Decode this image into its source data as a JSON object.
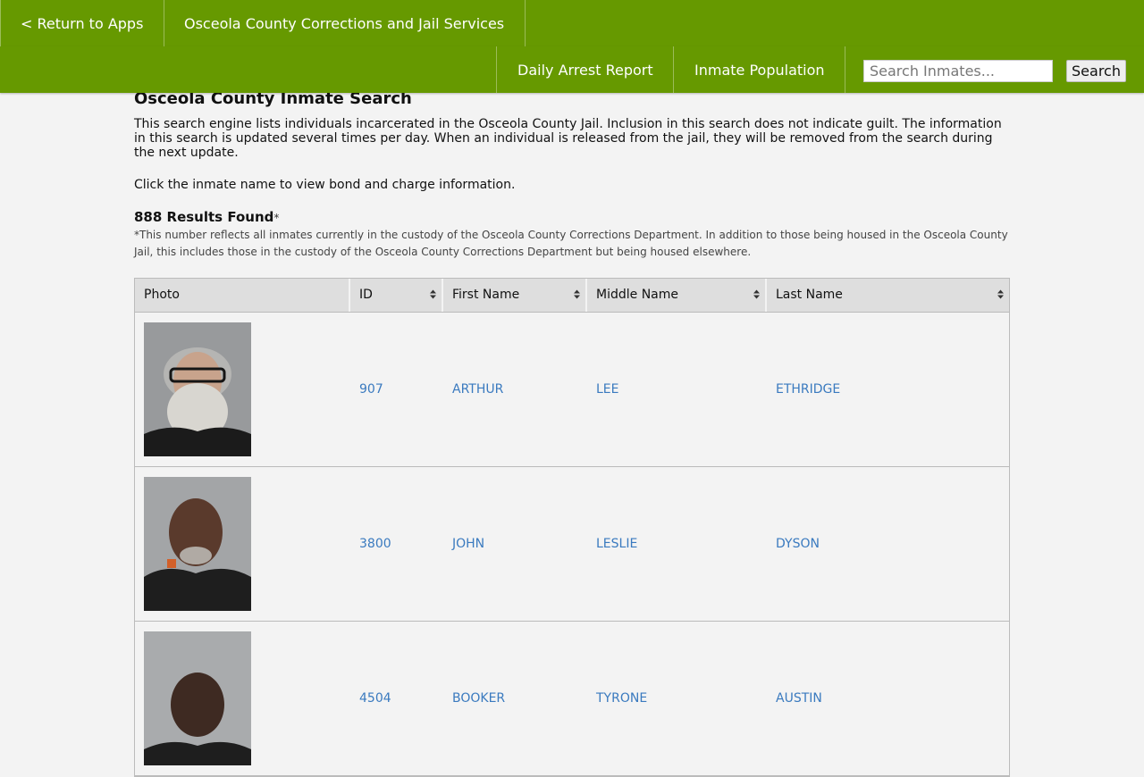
{
  "header": {
    "return_label": "< Return to Apps",
    "site_title": "Osceola County Corrections and Jail Services"
  },
  "subnav": {
    "daily_arrest_label": "Daily Arrest Report",
    "inmate_population_label": "Inmate Population",
    "search_placeholder": "Search Inmates...",
    "search_button_label": "Search"
  },
  "page": {
    "title": "Osceola County Inmate Search",
    "intro": "This search engine lists individuals incarcerated in the Osceola County Jail. Inclusion in this search does not indicate guilt. The information in this search is updated several times per day. When an individual is released from the jail, they will be removed from the search during the next update.",
    "instruction": "Click the inmate name to view bond and charge information.",
    "results_count": "888 Results Found",
    "results_asterisk": "*",
    "footnote": "*This number reflects all inmates currently in the custody of the Osceola County Corrections Department. In addition to those being housed in the Osceola County Jail, this includes those in the custody of the Osceola County Corrections Department but being housed elsewhere."
  },
  "table": {
    "columns": {
      "photo": "Photo",
      "id": "ID",
      "first_name": "First Name",
      "middle_name": "Middle Name",
      "last_name": "Last Name"
    },
    "rows": [
      {
        "id": "907",
        "first": "ARTHUR",
        "middle": "LEE",
        "last": "ETHRIDGE"
      },
      {
        "id": "3800",
        "first": "JOHN",
        "middle": "LESLIE",
        "last": "DYSON"
      },
      {
        "id": "4504",
        "first": "BOOKER",
        "middle": "TYRONE",
        "last": "AUSTIN"
      }
    ]
  },
  "colors": {
    "header_green": "#669900",
    "link_blue": "#3a7abf",
    "page_background": "#f3f3f3"
  },
  "icons": {
    "sort": "sort-icon"
  }
}
